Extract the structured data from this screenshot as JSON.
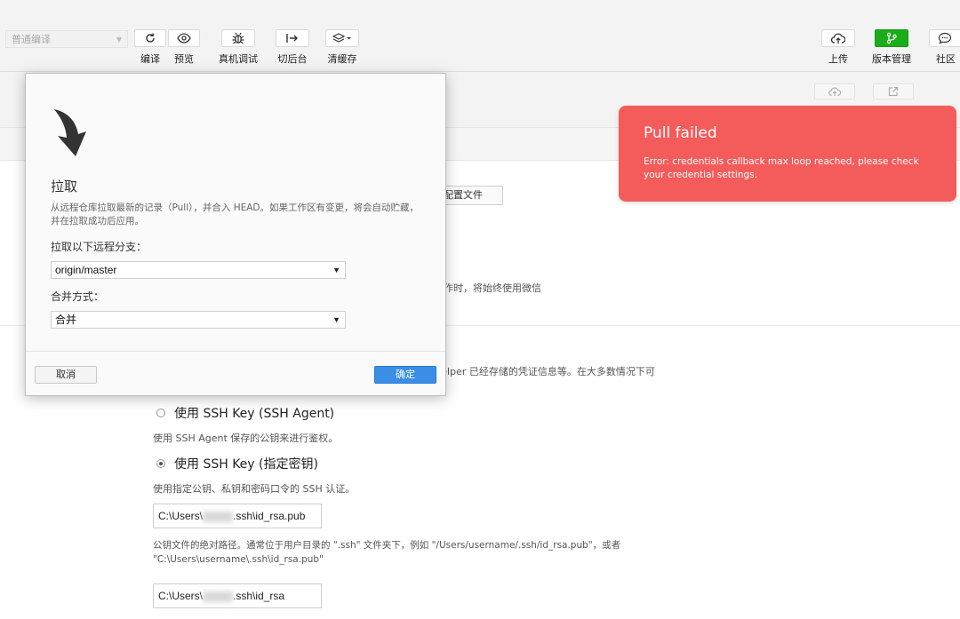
{
  "toolbar": {
    "mode_select": "普通编译",
    "left_buttons": [
      {
        "label": "编译",
        "icon": "refresh-icon"
      },
      {
        "label": "预览",
        "icon": "eye-icon"
      },
      {
        "label": "真机调试",
        "icon": "bug-icon"
      },
      {
        "label": "切后台",
        "icon": "switch-background-icon"
      },
      {
        "label": "清缓存",
        "icon": "layers-icon"
      }
    ],
    "right_buttons": [
      {
        "label": "上传",
        "icon": "cloud-upload-icon"
      },
      {
        "label": "版本管理",
        "icon": "branch-icon"
      },
      {
        "label": "社区",
        "icon": "chat-icon"
      }
    ],
    "accent_color": "#1aad19"
  },
  "subbar": {
    "icons": [
      "cloud-upload-icon",
      "open-external-icon"
    ]
  },
  "settings": {
    "config_button": "配置文件",
    "text_row_1": "操作时，将始终使用微信",
    "text_row_2": "Helper 已经存储的凭证信息等。在大多数情况下可",
    "ssh_agent_label": "使用 SSH Key (SSH Agent)",
    "ssh_agent_desc": "使用 SSH Agent 保存的公钥来进行鉴权。",
    "ssh_key_label": "使用 SSH Key (指定密钥)",
    "ssh_key_desc": "使用指定公钥、私钥和密码口令的 SSH 认证。",
    "public_key_prefix": "C:\\Users\\",
    "public_key_suffix": ".ssh\\id_rsa.pub",
    "public_key_desc_1": "公钥文件的绝对路径。通常位于用户目录的 \".ssh\" 文件夹下，例如 \"/Users/username/.ssh/id_rsa.pub\"，或者",
    "public_key_desc_2": "\"C:\\Users\\username\\.ssh\\id_rsa.pub\"",
    "private_key_prefix": "C:\\Users\\",
    "private_key_suffix": ".ssh\\id_rsa"
  },
  "dialog": {
    "title": "拉取",
    "description": "从远程仓库拉取最新的记录（Pull），并合入 HEAD。如果工作区有变更，将会自动贮藏，并在拉取成功后应用。",
    "branch_label": "拉取以下远程分支：",
    "branch_value": "origin/master",
    "merge_label": "合并方式：",
    "merge_value": "合并",
    "cancel": "取消",
    "confirm": "确定",
    "confirm_color": "#3b8ee6"
  },
  "toast": {
    "title": "Pull failed",
    "message": "Error: credentials callback max loop reached, please check your credential settings.",
    "color": "#f45b5b"
  }
}
